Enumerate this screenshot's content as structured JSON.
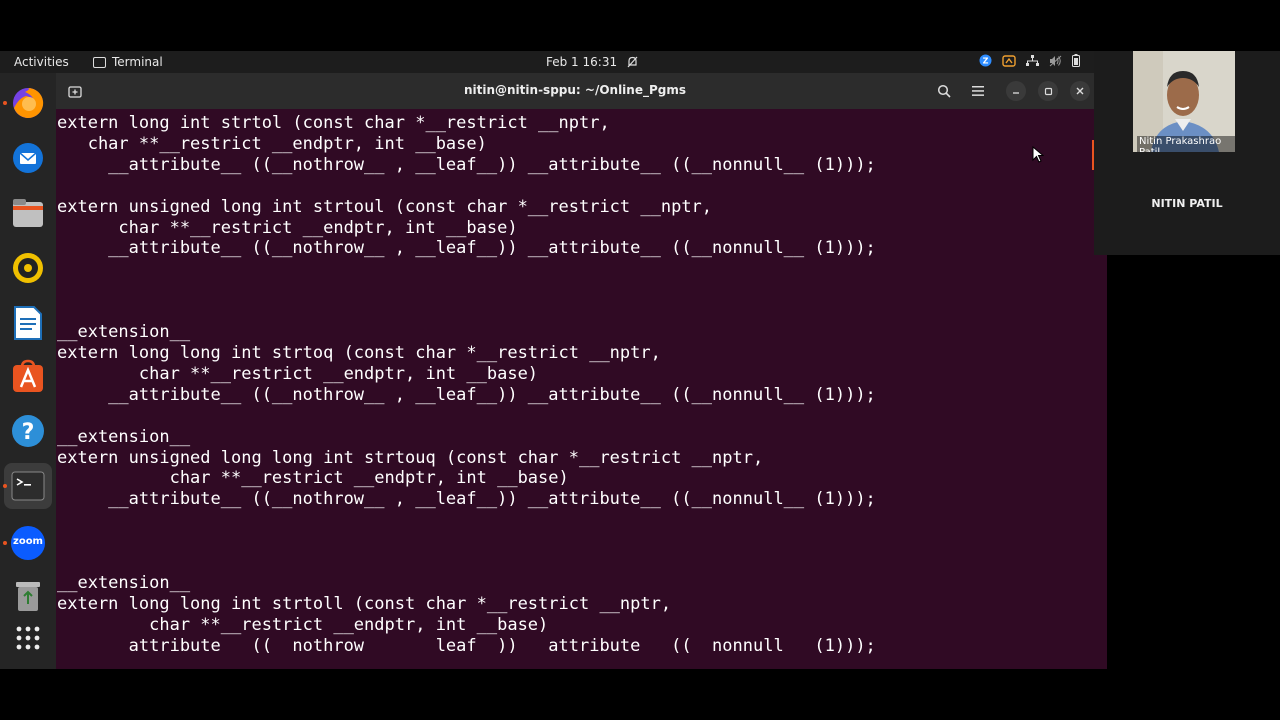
{
  "topbar": {
    "activities": "Activities",
    "app_name": "Terminal",
    "clock": "Feb 1  16:31",
    "tray_icons": [
      "zoom-tray-icon",
      "share-tray-icon",
      "network-icon",
      "volume-icon",
      "battery-icon"
    ]
  },
  "window": {
    "title": "nitin@nitin-sppu: ~/Online_Pgms"
  },
  "dock": {
    "apps": [
      "firefox",
      "thunderbird",
      "files",
      "rhythmbox",
      "libreoffice-writer",
      "app-center",
      "help",
      "terminal",
      "zoom",
      "trash",
      "show-apps"
    ],
    "zoom_label": "zoom"
  },
  "terminal": {
    "lines": [
      "extern long int strtol (const char *__restrict __nptr,",
      "   char **__restrict __endptr, int __base)",
      "     __attribute__ ((__nothrow__ , __leaf__)) __attribute__ ((__nonnull__ (1)));",
      "",
      "extern unsigned long int strtoul (const char *__restrict __nptr,",
      "      char **__restrict __endptr, int __base)",
      "     __attribute__ ((__nothrow__ , __leaf__)) __attribute__ ((__nonnull__ (1)));",
      "",
      "",
      "",
      "__extension__",
      "extern long long int strtoq (const char *__restrict __nptr,",
      "        char **__restrict __endptr, int __base)",
      "     __attribute__ ((__nothrow__ , __leaf__)) __attribute__ ((__nonnull__ (1)));",
      "",
      "__extension__",
      "extern unsigned long long int strtouq (const char *__restrict __nptr,",
      "           char **__restrict __endptr, int __base)",
      "     __attribute__ ((__nothrow__ , __leaf__)) __attribute__ ((__nonnull__ (1)));",
      "",
      "",
      "",
      "__extension__",
      "extern long long int strtoll (const char *__restrict __nptr,",
      "         char **__restrict __endptr, int __base)",
      "       attribute   ((  nothrow       leaf  ))   attribute   ((  nonnull   (1)));"
    ]
  },
  "video": {
    "participant_name": "Nitin Prakashrao Patil",
    "participant_label": "NITIN PATIL"
  },
  "colors": {
    "terminal_bg": "#300a24",
    "accent": "#e95420"
  }
}
